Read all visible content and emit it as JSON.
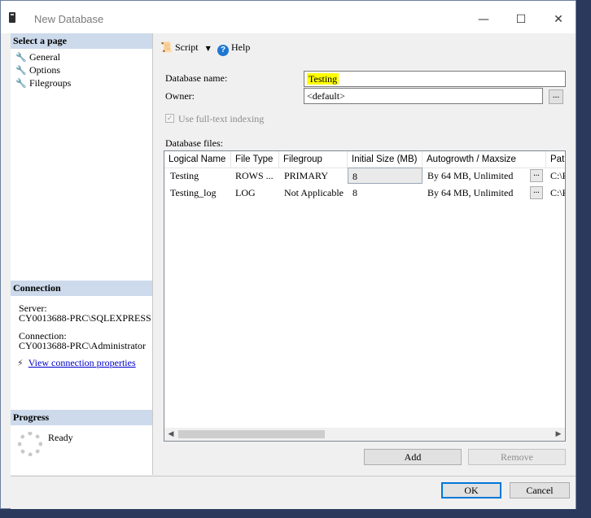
{
  "window": {
    "title": "New Database",
    "minimize_glyph": "—",
    "maximize_glyph": "☐",
    "close_glyph": "✕"
  },
  "left_pane": {
    "select_page_header": "Select a page",
    "pages": [
      {
        "label": "General",
        "icon": "wrench-icon"
      },
      {
        "label": "Options",
        "icon": "wrench-icon"
      },
      {
        "label": "Filegroups",
        "icon": "wrench-icon"
      }
    ],
    "connection_header": "Connection",
    "server_label": "Server:",
    "server_value": "CY0013688-PRC\\SQLEXPRESS",
    "connection_label": "Connection:",
    "connection_value": "CY0013688-PRC\\Administrator",
    "view_connection_link": "View connection properties",
    "progress_header": "Progress",
    "progress_status": "Ready"
  },
  "toolbar": {
    "script_label": "Script",
    "help_label": "Help"
  },
  "form": {
    "database_name_label": "Database name:",
    "database_name_value": "Testing",
    "owner_label": "Owner:",
    "owner_value": "<default>",
    "ellipsis": "...",
    "fulltext_label": "Use full-text indexing",
    "fulltext_checked": true,
    "database_files_label": "Database files:"
  },
  "files_grid": {
    "columns": [
      "Logical Name",
      "File Type",
      "Filegroup",
      "Initial Size (MB)",
      "Autogrowth / Maxsize",
      "Path"
    ],
    "rows": [
      {
        "logical_name": "Testing",
        "file_type": "ROWS ...",
        "filegroup": "PRIMARY",
        "initial_size": "8",
        "autogrowth": "By 64 MB, Unlimited",
        "path": "C:\\F"
      },
      {
        "logical_name": "Testing_log",
        "file_type": "LOG",
        "filegroup": "Not Applicable",
        "initial_size": "8",
        "autogrowth": "By 64 MB, Unlimited",
        "path": "C:\\F"
      }
    ],
    "cell_ellipsis": "..."
  },
  "buttons": {
    "add": "Add",
    "remove": "Remove",
    "ok": "OK",
    "cancel": "Cancel"
  },
  "colors": {
    "section_header_bg": "#ccdaeb",
    "link": "#0000cc",
    "highlight": "#ffff00",
    "default_button_border": "#0078d7"
  }
}
